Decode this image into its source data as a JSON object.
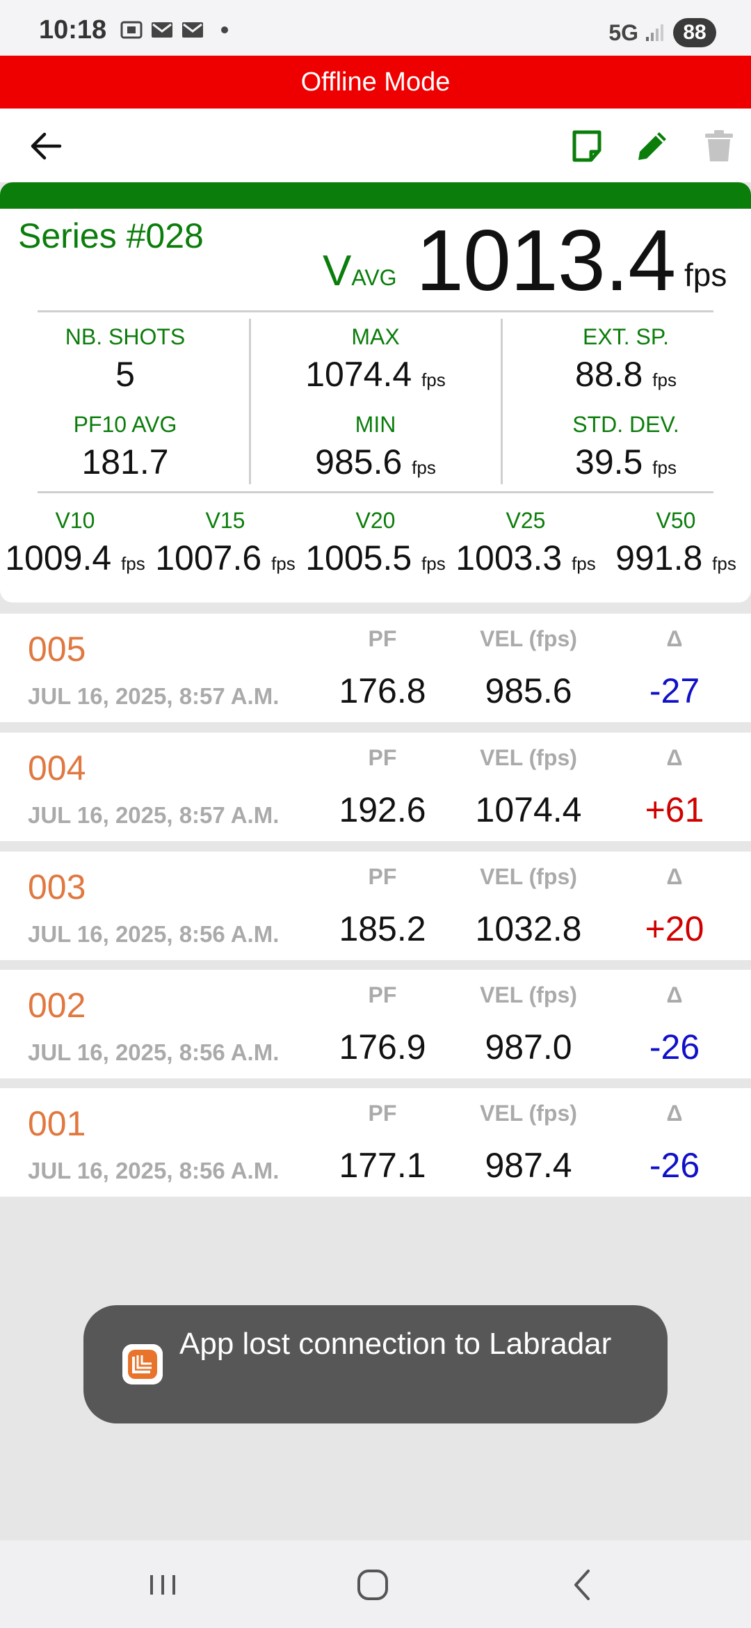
{
  "status_bar": {
    "time": "10:18",
    "network": "5G",
    "battery": "88"
  },
  "banner": {
    "text": "Offline Mode"
  },
  "colors": {
    "accent_green": "#0b7d0b",
    "banner_red": "#ef0000",
    "shot_id_orange": "#e07840",
    "delta_negative": "#1010c8",
    "delta_positive": "#d00000"
  },
  "series": {
    "title": "Series #028",
    "vavg_label_main": "V",
    "vavg_label_sub": "AVG",
    "vavg_value": "1013.4",
    "vavg_unit": "fps",
    "stats": {
      "nb_shots_label": "NB. SHOTS",
      "nb_shots_value": "5",
      "max_label": "MAX",
      "max_value": "1074.4",
      "ext_sp_label": "EXT. SP.",
      "ext_sp_value": "88.8",
      "pf10_label": "PF10 AVG",
      "pf10_value": "181.7",
      "min_label": "MIN",
      "min_value": "985.6",
      "std_dev_label": "STD. DEV.",
      "std_dev_value": "39.5",
      "unit": "fps"
    },
    "vx": [
      {
        "label": "V10",
        "value": "1009.4"
      },
      {
        "label": "V15",
        "value": "1007.6"
      },
      {
        "label": "V20",
        "value": "1005.5"
      },
      {
        "label": "V25",
        "value": "1003.3"
      },
      {
        "label": "V50",
        "value": "991.8"
      }
    ]
  },
  "shot_columns": {
    "pf": "PF",
    "vel": "VEL (fps)",
    "delta": "Δ"
  },
  "shots": [
    {
      "id": "005",
      "date": "JUL 16, 2025, 8:57 A.M.",
      "pf": "176.8",
      "vel": "985.6",
      "delta": "-27"
    },
    {
      "id": "004",
      "date": "JUL 16, 2025, 8:57 A.M.",
      "pf": "192.6",
      "vel": "1074.4",
      "delta": "+61"
    },
    {
      "id": "003",
      "date": "JUL 16, 2025, 8:56 A.M.",
      "pf": "185.2",
      "vel": "1032.8",
      "delta": "+20"
    },
    {
      "id": "002",
      "date": "JUL 16, 2025, 8:56 A.M.",
      "pf": "176.9",
      "vel": "987.0",
      "delta": "-26"
    },
    {
      "id": "001",
      "date": "JUL 16, 2025, 8:56 A.M.",
      "pf": "177.1",
      "vel": "987.4",
      "delta": "-26"
    }
  ],
  "toast": {
    "text": "App lost connection to Labradar"
  }
}
